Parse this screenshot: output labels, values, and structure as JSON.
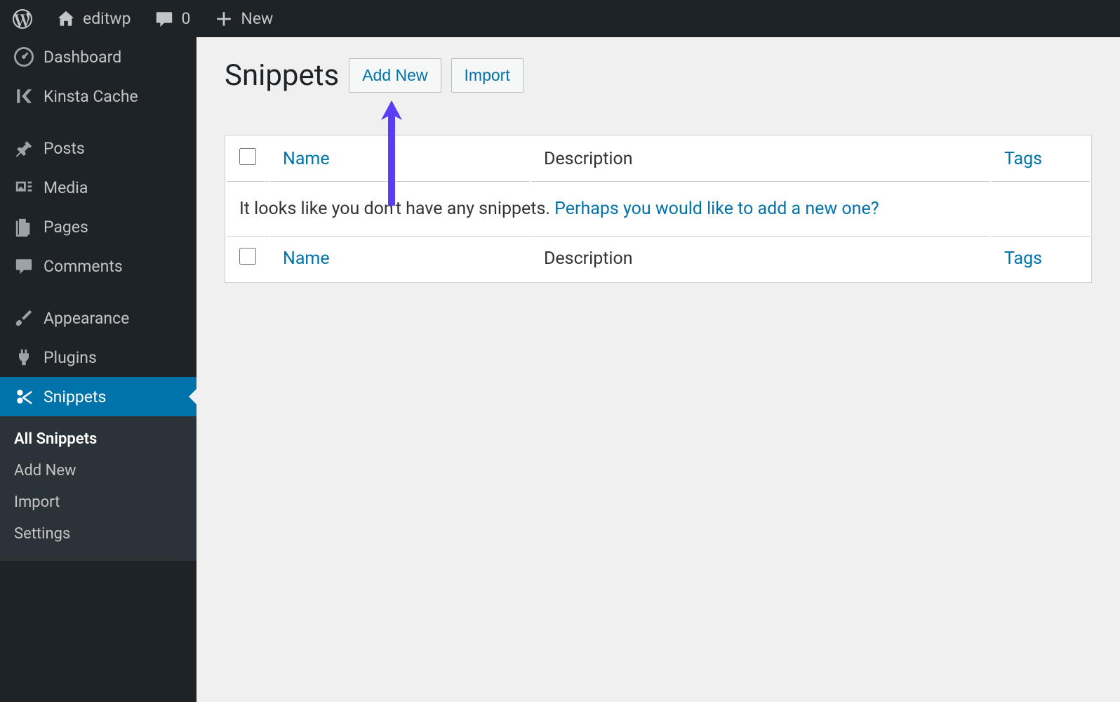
{
  "adminbar": {
    "site_name": "editwp",
    "comments_count": "0",
    "new_label": "New"
  },
  "sidebar": {
    "items": [
      {
        "label": "Dashboard",
        "icon": "dashboard"
      },
      {
        "label": "Kinsta Cache",
        "icon": "kinsta"
      },
      {
        "label": "Posts",
        "icon": "pin"
      },
      {
        "label": "Media",
        "icon": "media"
      },
      {
        "label": "Pages",
        "icon": "pages"
      },
      {
        "label": "Comments",
        "icon": "comment"
      },
      {
        "label": "Appearance",
        "icon": "brush"
      },
      {
        "label": "Plugins",
        "icon": "plug"
      },
      {
        "label": "Snippets",
        "icon": "scissors"
      }
    ],
    "submenu": [
      {
        "label": "All Snippets",
        "current": true
      },
      {
        "label": "Add New"
      },
      {
        "label": "Import"
      },
      {
        "label": "Settings"
      }
    ]
  },
  "page": {
    "title": "Snippets",
    "add_new_label": "Add New",
    "import_label": "Import"
  },
  "table": {
    "columns": {
      "name": "Name",
      "description": "Description",
      "tags": "Tags"
    },
    "empty_text": "It looks like you don't have any snippets. ",
    "empty_link": "Perhaps you would like to add a new one?"
  }
}
